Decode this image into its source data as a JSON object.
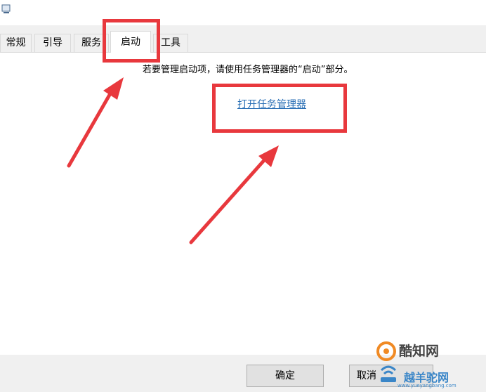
{
  "tabs": [
    {
      "label": "常规"
    },
    {
      "label": "引导"
    },
    {
      "label": "服务"
    },
    {
      "label": "启动"
    },
    {
      "label": "工具"
    }
  ],
  "active_tab": "启动",
  "content": {
    "message": "若要管理启动项，请使用任务管理器的“启动”部分。",
    "link_label": "打开任务管理器"
  },
  "footer": {
    "ok_label": "确定",
    "cancel_label": "取消"
  },
  "watermark": {
    "brand1": "酷知网",
    "brand2": "越羊驼网",
    "url": "www.yueyangbang.com"
  },
  "colors": {
    "annotation": "#e8383d",
    "link": "#2a6fb5"
  }
}
